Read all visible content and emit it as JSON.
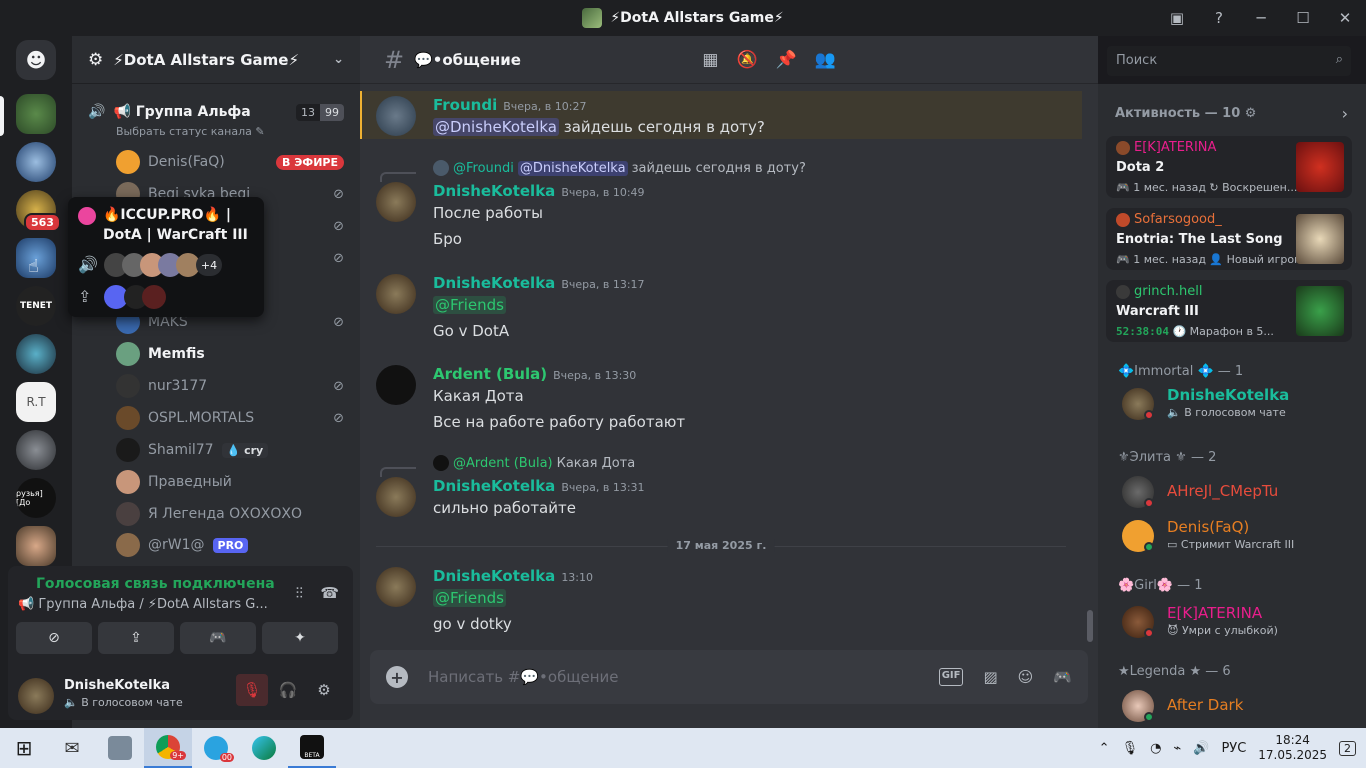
{
  "window": {
    "title": "⚡DotA Allstars Game⚡"
  },
  "server": {
    "name": "⚡DotA Allstars Game⚡"
  },
  "voice_channel": {
    "name": "📢 Группа Альфа",
    "count_a": "13",
    "count_b": "99",
    "status_placeholder": "Выбрать статус канала"
  },
  "members": [
    {
      "name": "Denis(FaQ)",
      "badge": "В ЭФИРЕ"
    },
    {
      "name": "Begi syka begi"
    },
    {
      "name": "MAKS"
    },
    {
      "name": "Memfis"
    },
    {
      "name": "nur3177"
    },
    {
      "name": "OSPL.MORTALS"
    },
    {
      "name": "Shamil77",
      "tag": "💧 cry"
    },
    {
      "name": "Праведный"
    },
    {
      "name": "Я Легенда ОХОХОХО"
    },
    {
      "name": "@rW1@",
      "tag": "PRO"
    }
  ],
  "popup": {
    "title": "🔥ICCUP.PRO🔥 | DotA | WarCraft III",
    "more": "+4"
  },
  "guild_badge": "563",
  "guild_labels": {
    "tenet": "TENET",
    "rt": "R.T",
    "friends": "рузья][До"
  },
  "voice_panel": {
    "status": "Голосовая связь подключена",
    "channel": "📢 Группа Альфа / ⚡DotA Allstars G...",
    "user": "DnisheKotelka",
    "user_status": "🔈 В голосовом чате"
  },
  "chat": {
    "channel": "💬•общение",
    "composer_placeholder": "Написать #💬•общение",
    "search_placeholder": "Поиск",
    "gif_label": "GIF",
    "messages": [
      {
        "author": "Froundi",
        "time": "Вчера, в 10:27",
        "mention": "@DnisheKotelka",
        "text": "зайдешь сегодня в доту?"
      },
      {
        "reply_author": "@Froundi",
        "reply_mention": "@DnisheKotelka",
        "reply_text": "зайдешь сегодня в доту?",
        "author": "DnisheKotelka",
        "time": "Вчера, в 10:49",
        "line1": "После работы",
        "line2": "Бро"
      },
      {
        "author": "DnisheKotelka",
        "time": "Вчера, в 13:17",
        "mention": "@Friends",
        "line2": "Go v DotA"
      },
      {
        "author": "Ardent (Bula)",
        "time": "Вчера, в 13:30",
        "line1": "Какая Дота",
        "line2": "Все на работе работу работают"
      },
      {
        "reply_author": "@Ardent (Bula)",
        "reply_text": "Какая Дота",
        "author": "DnisheKotelka",
        "time": "Вчера, в 13:31",
        "line1": "сильно работайте"
      },
      {
        "author": "DnisheKotelka",
        "time": "13:10",
        "mention": "@Friends",
        "line2": "go v dotky"
      }
    ],
    "divider": "17 мая 2025 г."
  },
  "activity": {
    "header": "Активность — 10 ⚙",
    "cards": [
      {
        "who": "E[K]ATERINA",
        "game": "Dota 2",
        "meta": "🎮 1 мес. назад  ↻ Воскрешен..."
      },
      {
        "who": "Sofarsogood_",
        "game": "Enotria: The Last Song",
        "meta": "🎮 1 мес. назад  👤 Новый игрок"
      },
      {
        "who": "grinch.hell",
        "game": "Warcraft III",
        "timer": "52:38:04",
        "meta": "🕐 Марафон в 5..."
      }
    ]
  },
  "roles": [
    {
      "label": "💠Immortal 💠 — 1",
      "members": [
        {
          "name": "DnisheKotelka",
          "status": "🔈 В голосовом чате",
          "color": "#1abc9c"
        }
      ]
    },
    {
      "label": "⚜Элита ⚜ — 2",
      "members": [
        {
          "name": "AHreJl_CMepTu",
          "color": "#e74c3c"
        },
        {
          "name": "Denis(FaQ)",
          "status": "▭ Стримит Warcraft III",
          "color": "#e67e22"
        }
      ]
    },
    {
      "label": "🌸Girl🌸 — 1",
      "members": [
        {
          "name": "E[K]ATERINA",
          "status": "😈 Умри с улыбкой)",
          "color": "#e91e8c"
        }
      ]
    },
    {
      "label": "★Legenda ★ — 6",
      "members": [
        {
          "name": "After Dark",
          "color": "#e67e22"
        }
      ]
    }
  ],
  "taskbar": {
    "lang": "РУС",
    "time": "18:24",
    "date": "17.05.2025",
    "notif": "2",
    "telegram_badge": "00",
    "chrome_badge": "9+",
    "beta": "BETA"
  },
  "colors": {
    "accent": "#5865f2",
    "green": "#23a55a",
    "teal": "#1abc9c",
    "red": "#da373c"
  }
}
